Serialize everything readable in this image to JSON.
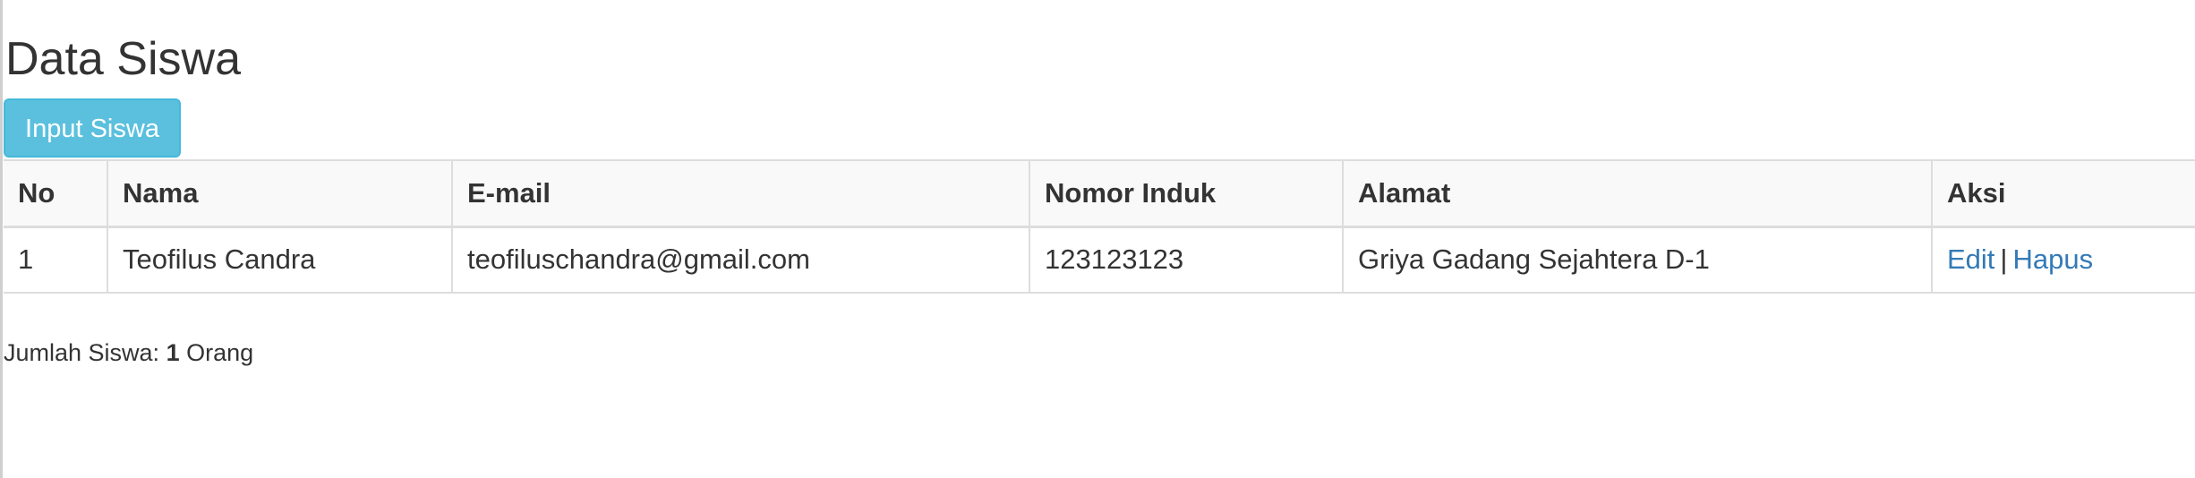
{
  "page": {
    "title": "Data Siswa"
  },
  "toolbar": {
    "input_button_label": "Input Siswa"
  },
  "table": {
    "headers": [
      "No",
      "Nama",
      "E-mail",
      "Nomor Induk",
      "Alamat",
      "Aksi"
    ],
    "rows": [
      {
        "no": "1",
        "nama": "Teofilus Candra",
        "email": "teofiluschandra@gmail.com",
        "nomor_induk": "123123123",
        "alamat": "Griya Gadang Sejahtera D-1",
        "aksi_edit": "Edit",
        "aksi_separator": "|",
        "aksi_hapus": "Hapus"
      }
    ]
  },
  "summary": {
    "prefix": "Jumlah Siswa:",
    "count": "1",
    "suffix": "Orang"
  },
  "colors": {
    "button_bg": "#5bc0de",
    "button_border": "#46b8da",
    "link": "#337ab7",
    "text": "#333333",
    "table_border": "#dddddd"
  }
}
